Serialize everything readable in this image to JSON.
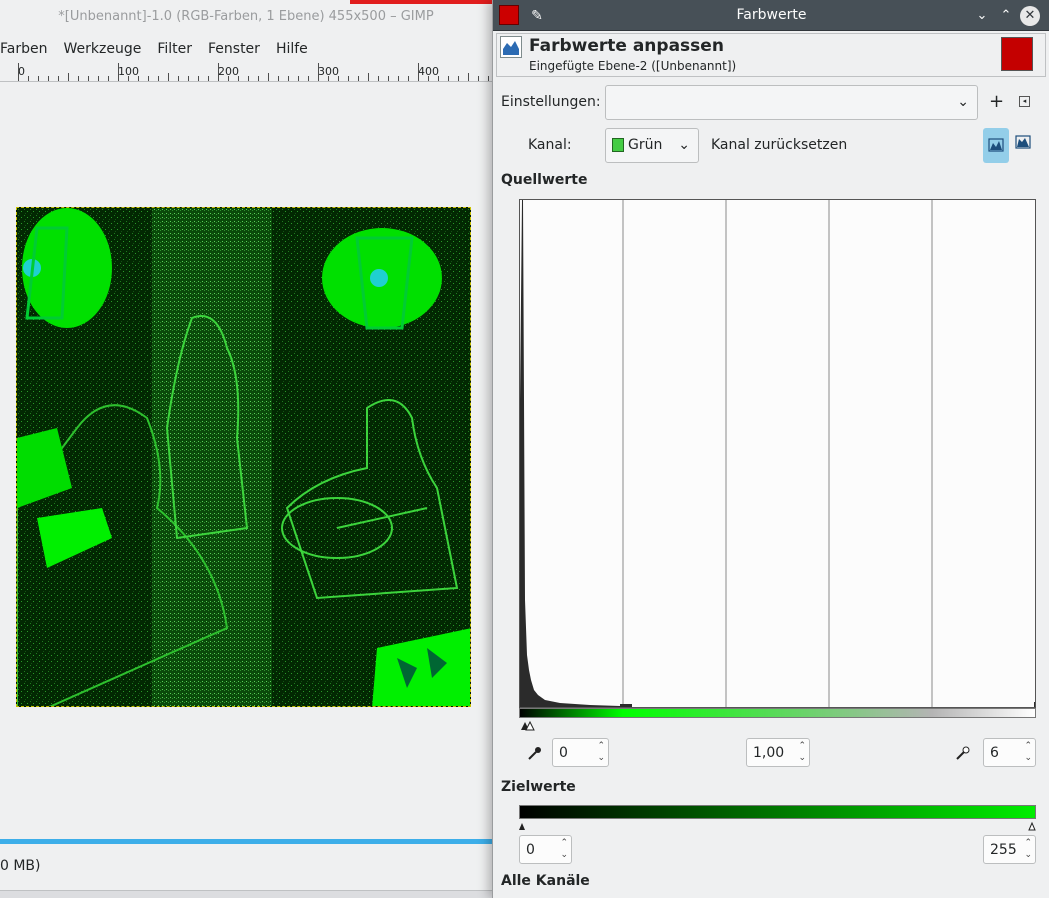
{
  "gimp": {
    "title": "*[Unbenannt]-1.0 (RGB-Farben, 1 Ebene) 455x500 – GIMP",
    "menu": [
      "Farben",
      "Werkzeuge",
      "Filter",
      "Fenster",
      "Hilfe"
    ],
    "ruler_labels": [
      "0",
      "100",
      "200",
      "300",
      "400"
    ],
    "status_text": "0 MB)"
  },
  "dialog": {
    "window_title": "Farbwerte",
    "header_title": "Farbwerte anpassen",
    "header_subtitle": "Eingefügte Ebene-2 ([Unbenannt])",
    "settings_label": "Einstellungen:",
    "settings_value": "",
    "add_label": "+",
    "channel_label": "Kanal:",
    "channel_value": "Grün",
    "reset_channel_label": "Kanal zurücksetzen",
    "source_section": "Quellwerte",
    "input_low": "0",
    "input_gamma": "1,00",
    "input_high": "6",
    "target_section": "Zielwerte",
    "output_low": "0",
    "output_high": "255",
    "all_channels_section": "Alle Kanäle"
  },
  "colors": {
    "accent": "#3daee9",
    "titlebar": "#475057",
    "channel_green": "#00ff00"
  }
}
